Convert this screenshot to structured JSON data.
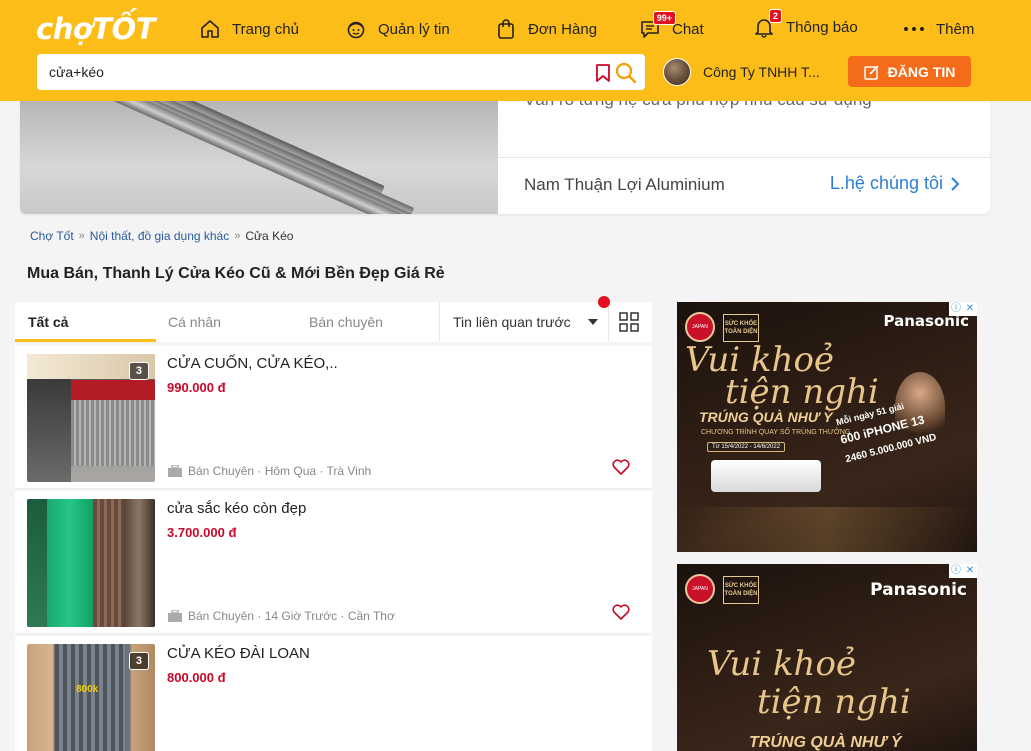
{
  "header": {
    "logo": "chợTỐT",
    "nav": [
      {
        "label": "Trang chủ",
        "icon": "home-icon"
      },
      {
        "label": "Quản lý tin",
        "icon": "manage-icon"
      },
      {
        "label": "Đơn Hàng",
        "icon": "bag-icon"
      },
      {
        "label": "Chat",
        "icon": "chat-icon",
        "badge": "99+"
      },
      {
        "label": "Thông báo",
        "icon": "bell-icon",
        "badge": "2"
      },
      {
        "label": "Thêm",
        "icon": "more-icon"
      }
    ],
    "search_value": "cửa+kéo",
    "user_name": "Công Ty TNHH T...",
    "post_label": "ĐĂNG TIN"
  },
  "banner": {
    "description": "Vẫn rỏ từng hệ cửa phù hợp nhu cầu sử dụng",
    "company": "Nam Thuận Lợi Aluminium",
    "contact": "L.hệ chúng tôi"
  },
  "breadcrumb": [
    "Chợ Tốt",
    "Nội thất, đồ gia dụng khác",
    "Cửa Kéo"
  ],
  "page_title": "Mua Bán, Thanh Lý Cửa Kéo Cũ & Mới Bền Đẹp Giá Rẻ",
  "tabs": [
    "Tất cả",
    "Cá nhân",
    "Bán chuyên"
  ],
  "sort_label": "Tin liên quan trước",
  "listings": [
    {
      "title": "CỬA CUỐN, CỬA KÉO,..",
      "price": "990.000 đ",
      "meta": "Bán Chuyên · Hôm Qua · Trà Vinh",
      "image_count": "3"
    },
    {
      "title": "cửa sắc kéo còn đẹp",
      "price": "3.700.000 đ",
      "meta": "Bán Chuyên · 14 Giờ Trước · Cần Thơ",
      "image_count": ""
    },
    {
      "title": "CỬA KÉO ĐÀI LOAN",
      "price": "800.000 đ",
      "meta": "",
      "image_count": "3",
      "image_label": "800k"
    }
  ],
  "ads": [
    {
      "brand": "Panasonic",
      "badge_left": "JAPAN",
      "badge_right": "SỨC KHỎE TOÀN DIỆN",
      "slogan1": "Vui khoẻ",
      "slogan2": "tiện nghi",
      "prize": "TRÚNG QUÀ NHƯ Ý",
      "sub": "CHƯƠNG TRÌNH QUAY SỐ TRÚNG THƯỞNG",
      "dates": "Từ 15/4/2022 - 14/6/2022",
      "phone_line1": "Mỗi ngày 51 giải",
      "phone_line2": "600 iPHONE 13",
      "phone_line3": "2460 5.000.000 VND"
    },
    {
      "brand": "Panasonic",
      "badge_left": "JAPAN",
      "badge_right": "SỨC KHỎE TOÀN DIỆN",
      "slogan1": "Vui khoẻ",
      "slogan2": "tiện nghi",
      "prize": "TRÚNG QUÀ NHƯ Ý"
    }
  ],
  "colors": {
    "brand_yellow": "#fdbd18",
    "post_orange": "#f46c19",
    "price_red": "#c90927",
    "link_blue": "#2d7fd1"
  }
}
